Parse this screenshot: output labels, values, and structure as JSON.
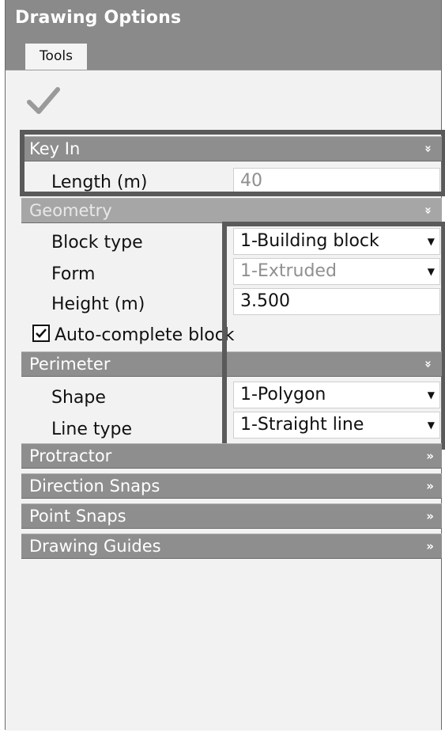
{
  "window": {
    "title": "Drawing Options"
  },
  "tabs": [
    {
      "label": "Tools"
    }
  ],
  "toolbar": {
    "apply_icon": "checkmark-icon"
  },
  "sections": {
    "key_in": {
      "label": "Key In",
      "chevron": "»",
      "fields": {
        "length": {
          "label": "Length (m)",
          "value": "40"
        }
      }
    },
    "geometry": {
      "label": "Geometry",
      "chevron": "»",
      "fields": {
        "block_type": {
          "label": "Block type",
          "value": "1-Building block"
        },
        "form": {
          "label": "Form",
          "value": "1-Extruded"
        },
        "height": {
          "label": "Height (m)",
          "value": "3.500"
        }
      },
      "auto_complete": {
        "label": "Auto-complete block",
        "checked": true
      }
    },
    "perimeter": {
      "label": "Perimeter",
      "chevron": "»",
      "fields": {
        "shape": {
          "label": "Shape",
          "value": "1-Polygon"
        },
        "line_type": {
          "label": "Line type",
          "value": "1-Straight line"
        }
      }
    },
    "protractor": {
      "label": "Protractor",
      "chevron": "»"
    },
    "direction_snaps": {
      "label": "Direction Snaps",
      "chevron": "»"
    },
    "point_snaps": {
      "label": "Point Snaps",
      "chevron": "»"
    },
    "drawing_guides": {
      "label": "Drawing Guides",
      "chevron": "»"
    }
  },
  "dropdown_arrow": "▼"
}
